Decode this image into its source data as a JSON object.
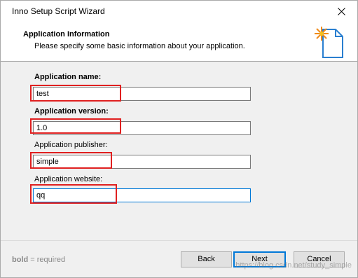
{
  "window": {
    "title": "Inno Setup Script Wizard"
  },
  "header": {
    "title": "Application Information",
    "subtitle": "Please specify some basic information about your application.",
    "icon": "wizard-document-sparkle-icon"
  },
  "fields": {
    "name": {
      "label": "Application name:",
      "value": "test",
      "required": true
    },
    "version": {
      "label": "Application version:",
      "value": "1.0",
      "required": true
    },
    "publisher": {
      "label": "Application publisher:",
      "value": "simple",
      "required": false
    },
    "website": {
      "label": "Application website:",
      "value": "qq",
      "required": false
    }
  },
  "footer": {
    "note_bold": "bold",
    "note_rest": " = required",
    "back_label": "Back",
    "next_label": "Next",
    "cancel_label": "Cancel"
  },
  "watermark": "https://blog.csdn.net/study_simple",
  "colors": {
    "highlight": "#e02020",
    "focus": "#0078d7"
  }
}
